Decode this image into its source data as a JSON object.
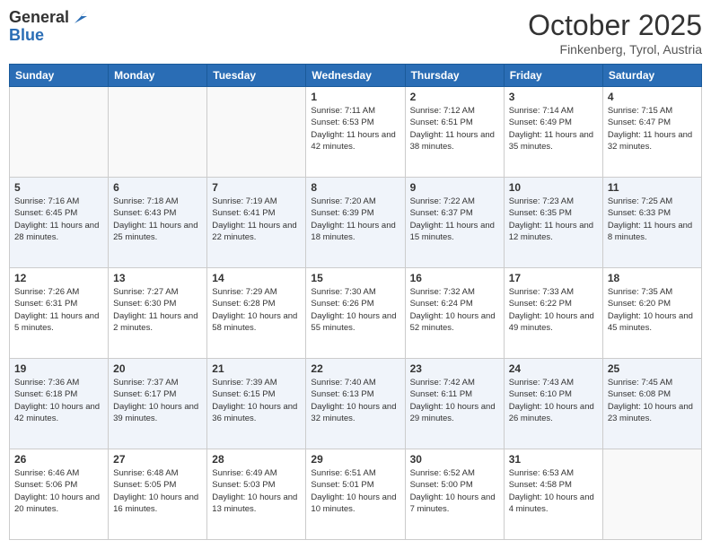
{
  "logo": {
    "general": "General",
    "blue": "Blue"
  },
  "title": "October 2025",
  "location": "Finkenberg, Tyrol, Austria",
  "days_of_week": [
    "Sunday",
    "Monday",
    "Tuesday",
    "Wednesday",
    "Thursday",
    "Friday",
    "Saturday"
  ],
  "weeks": [
    [
      {
        "day": "",
        "info": ""
      },
      {
        "day": "",
        "info": ""
      },
      {
        "day": "",
        "info": ""
      },
      {
        "day": "1",
        "info": "Sunrise: 7:11 AM\nSunset: 6:53 PM\nDaylight: 11 hours and 42 minutes."
      },
      {
        "day": "2",
        "info": "Sunrise: 7:12 AM\nSunset: 6:51 PM\nDaylight: 11 hours and 38 minutes."
      },
      {
        "day": "3",
        "info": "Sunrise: 7:14 AM\nSunset: 6:49 PM\nDaylight: 11 hours and 35 minutes."
      },
      {
        "day": "4",
        "info": "Sunrise: 7:15 AM\nSunset: 6:47 PM\nDaylight: 11 hours and 32 minutes."
      }
    ],
    [
      {
        "day": "5",
        "info": "Sunrise: 7:16 AM\nSunset: 6:45 PM\nDaylight: 11 hours and 28 minutes."
      },
      {
        "day": "6",
        "info": "Sunrise: 7:18 AM\nSunset: 6:43 PM\nDaylight: 11 hours and 25 minutes."
      },
      {
        "day": "7",
        "info": "Sunrise: 7:19 AM\nSunset: 6:41 PM\nDaylight: 11 hours and 22 minutes."
      },
      {
        "day": "8",
        "info": "Sunrise: 7:20 AM\nSunset: 6:39 PM\nDaylight: 11 hours and 18 minutes."
      },
      {
        "day": "9",
        "info": "Sunrise: 7:22 AM\nSunset: 6:37 PM\nDaylight: 11 hours and 15 minutes."
      },
      {
        "day": "10",
        "info": "Sunrise: 7:23 AM\nSunset: 6:35 PM\nDaylight: 11 hours and 12 minutes."
      },
      {
        "day": "11",
        "info": "Sunrise: 7:25 AM\nSunset: 6:33 PM\nDaylight: 11 hours and 8 minutes."
      }
    ],
    [
      {
        "day": "12",
        "info": "Sunrise: 7:26 AM\nSunset: 6:31 PM\nDaylight: 11 hours and 5 minutes."
      },
      {
        "day": "13",
        "info": "Sunrise: 7:27 AM\nSunset: 6:30 PM\nDaylight: 11 hours and 2 minutes."
      },
      {
        "day": "14",
        "info": "Sunrise: 7:29 AM\nSunset: 6:28 PM\nDaylight: 10 hours and 58 minutes."
      },
      {
        "day": "15",
        "info": "Sunrise: 7:30 AM\nSunset: 6:26 PM\nDaylight: 10 hours and 55 minutes."
      },
      {
        "day": "16",
        "info": "Sunrise: 7:32 AM\nSunset: 6:24 PM\nDaylight: 10 hours and 52 minutes."
      },
      {
        "day": "17",
        "info": "Sunrise: 7:33 AM\nSunset: 6:22 PM\nDaylight: 10 hours and 49 minutes."
      },
      {
        "day": "18",
        "info": "Sunrise: 7:35 AM\nSunset: 6:20 PM\nDaylight: 10 hours and 45 minutes."
      }
    ],
    [
      {
        "day": "19",
        "info": "Sunrise: 7:36 AM\nSunset: 6:18 PM\nDaylight: 10 hours and 42 minutes."
      },
      {
        "day": "20",
        "info": "Sunrise: 7:37 AM\nSunset: 6:17 PM\nDaylight: 10 hours and 39 minutes."
      },
      {
        "day": "21",
        "info": "Sunrise: 7:39 AM\nSunset: 6:15 PM\nDaylight: 10 hours and 36 minutes."
      },
      {
        "day": "22",
        "info": "Sunrise: 7:40 AM\nSunset: 6:13 PM\nDaylight: 10 hours and 32 minutes."
      },
      {
        "day": "23",
        "info": "Sunrise: 7:42 AM\nSunset: 6:11 PM\nDaylight: 10 hours and 29 minutes."
      },
      {
        "day": "24",
        "info": "Sunrise: 7:43 AM\nSunset: 6:10 PM\nDaylight: 10 hours and 26 minutes."
      },
      {
        "day": "25",
        "info": "Sunrise: 7:45 AM\nSunset: 6:08 PM\nDaylight: 10 hours and 23 minutes."
      }
    ],
    [
      {
        "day": "26",
        "info": "Sunrise: 6:46 AM\nSunset: 5:06 PM\nDaylight: 10 hours and 20 minutes."
      },
      {
        "day": "27",
        "info": "Sunrise: 6:48 AM\nSunset: 5:05 PM\nDaylight: 10 hours and 16 minutes."
      },
      {
        "day": "28",
        "info": "Sunrise: 6:49 AM\nSunset: 5:03 PM\nDaylight: 10 hours and 13 minutes."
      },
      {
        "day": "29",
        "info": "Sunrise: 6:51 AM\nSunset: 5:01 PM\nDaylight: 10 hours and 10 minutes."
      },
      {
        "day": "30",
        "info": "Sunrise: 6:52 AM\nSunset: 5:00 PM\nDaylight: 10 hours and 7 minutes."
      },
      {
        "day": "31",
        "info": "Sunrise: 6:53 AM\nSunset: 4:58 PM\nDaylight: 10 hours and 4 minutes."
      },
      {
        "day": "",
        "info": ""
      }
    ]
  ]
}
